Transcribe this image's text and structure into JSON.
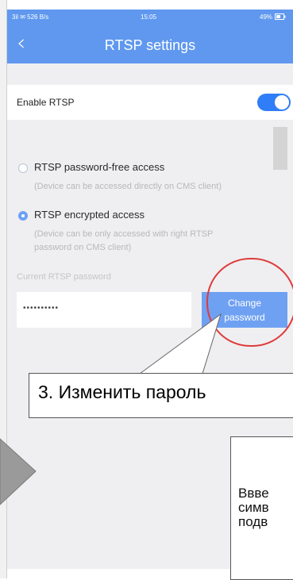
{
  "status": {
    "left": "3il ✉ 526 B/s",
    "time": "15:05",
    "battery": "49%"
  },
  "header": {
    "back_icon": "chevron-left-icon",
    "title": "RTSP settings"
  },
  "enable": {
    "label": "Enable RTSP",
    "toggle_on": true
  },
  "options": [
    {
      "title": "RTSP password-free access",
      "desc1": "(Device can be accessed directly on CMS client)",
      "selected": false
    },
    {
      "title": "RTSP encrypted access",
      "desc1": "(Device can be only accessed with right RTSP",
      "desc2": "password on CMS client)",
      "selected": true
    }
  ],
  "current_password": {
    "label": "Current RTSP password",
    "value": "••••••••••"
  },
  "change_button": {
    "line1": "Change",
    "line2": "password"
  },
  "callout": {
    "text": "3. Изменить пароль"
  },
  "partial_box": {
    "line1": "Ввве",
    "line2": "симв",
    "line3": "подв"
  },
  "colors": {
    "accent": "#5f98ee",
    "button": "#6fa1f3",
    "highlight": "#e03a3a"
  }
}
